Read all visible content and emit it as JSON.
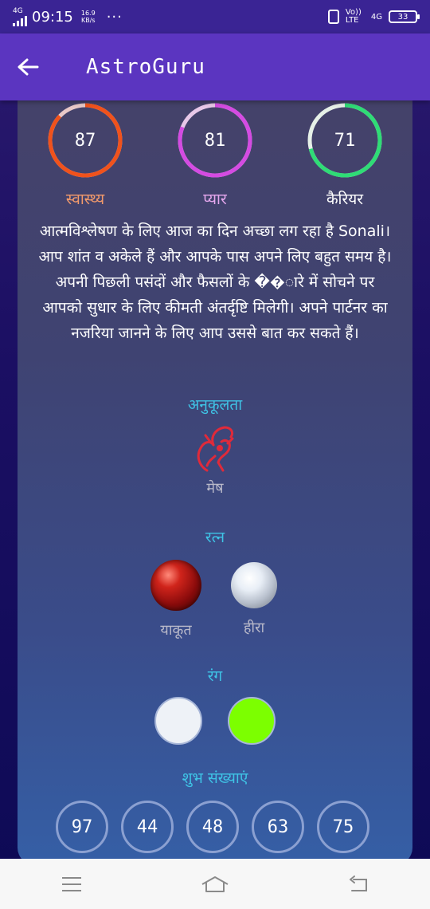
{
  "status_bar": {
    "network": "4G",
    "time": "09:15",
    "speed_value": "16.9",
    "speed_unit": "KB/s",
    "more": "···",
    "volte_label": "Vo)) LTE",
    "net_right": "4G",
    "battery": "33"
  },
  "app_bar": {
    "title": "AstroGuru",
    "back_icon": "arrow-left-icon"
  },
  "meters": [
    {
      "value": "87",
      "label": "स्वास्थ्य",
      "percent": 87,
      "color": "#f0521c",
      "label_color": "#f39a6b"
    },
    {
      "value": "81",
      "label": "प्यार",
      "percent": 81,
      "color": "#d44be2",
      "label_color": "#e6a8ef"
    },
    {
      "value": "71",
      "label": "कैरियर",
      "percent": 71,
      "color": "#2fdc76",
      "label_color": "#ffffff"
    }
  ],
  "description": "आत्मविश्लेषण के लिए आज का दिन अच्छा लग रहा है Sonali। आप शांत व अकेले हैं और आपके पास अपने लिए बहुत समय है। अपनी पिछली पसंदों और फैसलों के ��ारे में सोचने पर आपको सुधार के लिए कीमती अंतर्दृष्टि मिलेगी। अपने पार्टनर का नजरिया जानने के लिए आप उससे बात कर सकते हैं।",
  "compatibility": {
    "heading": "अनुकूलता",
    "sign": "मेष",
    "icon": "aries-ram-icon"
  },
  "gems": {
    "heading": "रत्न",
    "items": [
      {
        "label": "याकूत",
        "icon": "ruby-gem-icon"
      },
      {
        "label": "हीरा",
        "icon": "diamond-gem-icon"
      }
    ]
  },
  "colors": {
    "heading": "रंग",
    "items": [
      "#eef2f7",
      "#7cff00"
    ]
  },
  "lucky_numbers": {
    "heading": "शुभ संख्याएं",
    "items": [
      "97",
      "44",
      "48",
      "63",
      "75"
    ]
  },
  "nav_bar": {
    "icons": [
      "menu-icon",
      "home-icon",
      "back-icon"
    ]
  }
}
